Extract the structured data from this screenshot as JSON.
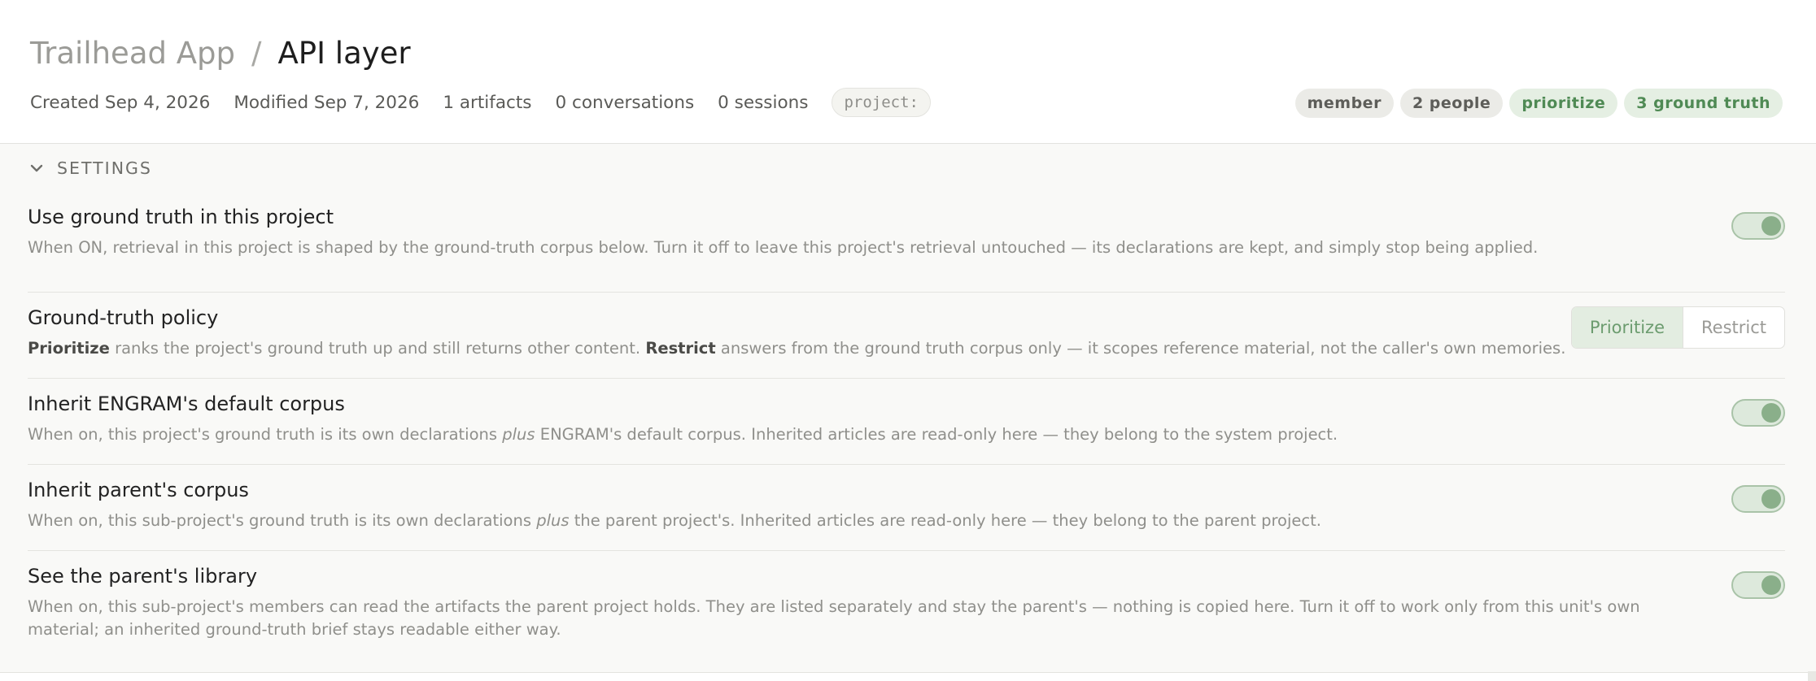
{
  "breadcrumb": {
    "parent": "Trailhead App",
    "separator": "/",
    "current": "API layer"
  },
  "meta": {
    "created": "Created Sep 4, 2026",
    "modified": "Modified Sep 7, 2026",
    "artifacts": "1 artifacts",
    "conversations": "0 conversations",
    "sessions": "0 sessions",
    "project_code": "project:"
  },
  "badges": {
    "role": "member",
    "people": "2 people",
    "policy": "prioritize",
    "ground_truth": "3 ground truth"
  },
  "colors": {
    "accent_green": "#8aaf8a",
    "badge_green_text": "#4f8a54"
  },
  "settings": {
    "title": "SETTINGS",
    "icon": "chevron-down-icon",
    "use_ground_truth": {
      "title": "Use ground truth in this project",
      "desc": "When ON, retrieval in this project is shaped by the ground-truth corpus below. Turn it off to leave this project's retrieval untouched — its declarations are kept, and simply stop being applied.",
      "on": true
    },
    "policy": {
      "title": "Ground-truth policy",
      "desc_b1": "Prioritize",
      "desc_1": " ranks the project's ground truth up and still returns other content. ",
      "desc_b2": "Restrict",
      "desc_2": " answers from the ground truth corpus only — it scopes reference material, not the caller's own memories.",
      "options": [
        "Prioritize",
        "Restrict"
      ],
      "selected": "Prioritize"
    },
    "inherit_engram": {
      "title": "Inherit ENGRAM's default corpus",
      "desc_1": "When on, this project's ground truth is its own declarations ",
      "desc_em": "plus",
      "desc_2": " ENGRAM's default corpus. Inherited articles are read-only here — they belong to the system project.",
      "on": true
    },
    "inherit_parent": {
      "title": "Inherit parent's corpus",
      "desc_1": "When on, this sub-project's ground truth is its own declarations ",
      "desc_em": "plus",
      "desc_2": " the parent project's. Inherited articles are read-only here — they belong to the parent project.",
      "on": true
    },
    "parent_library": {
      "title": "See the parent's library",
      "desc": "When on, this sub-project's members can read the artifacts the parent project holds. They are listed separately and stay the parent's — nothing is copied here. Turn it off to work only from this unit's own material; an inherited ground-truth brief stays readable either way.",
      "on": true
    }
  }
}
